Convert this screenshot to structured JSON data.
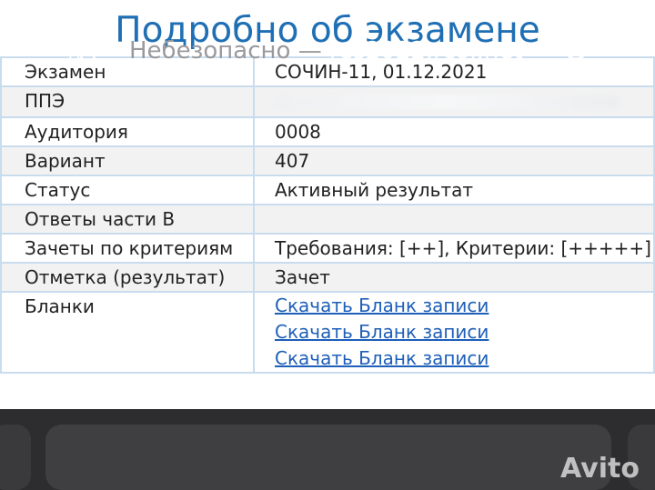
{
  "page": {
    "title": "Подробно об экзамене"
  },
  "details": {
    "rows": [
      {
        "label": "Экзамен",
        "value": "СОЧИН-11, 01.12.2021"
      },
      {
        "label": "ППЭ",
        "value": ""
      },
      {
        "label": "Аудитория",
        "value": "0008"
      },
      {
        "label": "Вариант",
        "value": "407"
      },
      {
        "label": "Статус",
        "value": "Активный результат"
      },
      {
        "label": "Ответы части B",
        "value": ""
      },
      {
        "label": "Зачеты по критериям",
        "value": "Требования: [++], Критерии: [+++++]"
      },
      {
        "label": "Отметка (результат)",
        "value": "Зачет"
      },
      {
        "label": "Бланки",
        "value": ""
      }
    ],
    "downloads": [
      "Скачать Бланк записи",
      "Скачать Бланк записи",
      "Скачать Бланк записи"
    ]
  },
  "browser": {
    "text_size_button": {
      "small": "A",
      "large": "A"
    },
    "url_insecure": "Небезопасно —",
    "url_domain": "res2022.rcoi.net"
  },
  "watermark": "Avito",
  "colors": {
    "title": "#1f6fb5",
    "link": "#1e5fb8",
    "table_border": "#c9dcee",
    "toolbar": "#2d2d2f"
  }
}
